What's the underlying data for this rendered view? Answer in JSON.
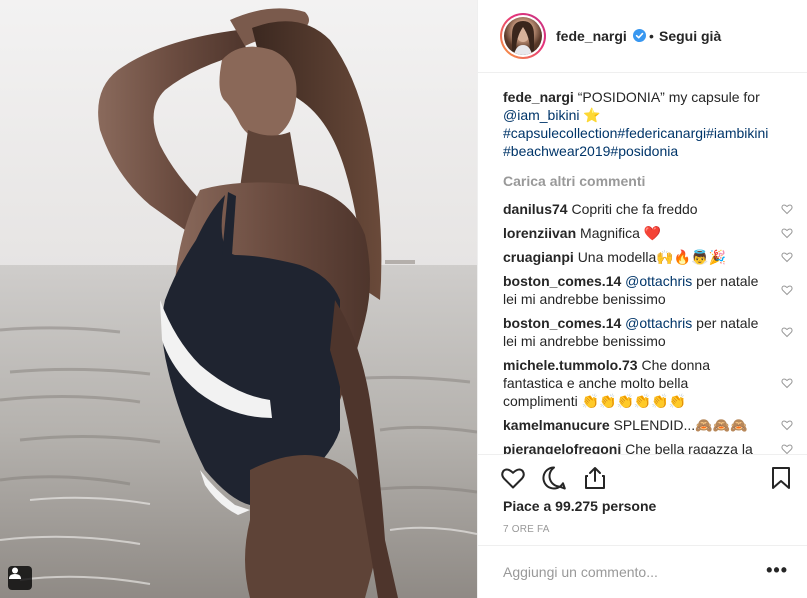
{
  "post": {
    "username": "fede_nargi",
    "verified": true,
    "follow_label": "Segui già",
    "separator": "•",
    "caption_user": "fede_nargi",
    "caption_text": "“POSIDONIA” my capsule for",
    "caption_mention": "@iam_bikini",
    "caption_emoji": "⭐",
    "caption_hashtags_line1": "#capsulecollection#federicanargi#iambikini",
    "caption_hashtags_line2": "#beachwear2019#posidonia"
  },
  "load_more_label": "Carica altri commenti",
  "comments": [
    {
      "user": "danilus74",
      "text": "Copriti che fa freddo"
    },
    {
      "user": "lorenziivan",
      "text": "Magnifica ❤️"
    },
    {
      "user": "cruagianpi",
      "text": "Una modella🙌🔥👼🎉"
    },
    {
      "user": "boston_comes.14",
      "mention": "@ottachris",
      "text": " per natale lei mi andrebbe benissimo"
    },
    {
      "user": "boston_comes.14",
      "mention": "@ottachris",
      "text": " per natale lei mi andrebbe benissimo"
    },
    {
      "user": "michele.tummolo.73",
      "text": "Che donna fantastica e anche molto bella complimenti 👏👏👏👏👏👏"
    },
    {
      "user": "kamelmanucure",
      "text": "SPLENDID...🙈🙈🙈"
    },
    {
      "user": "pierangelofregoni",
      "text": "Che bella ragazza la"
    }
  ],
  "likes_text": "Piace a 99.275 persone",
  "timestamp": "7 ORE FA",
  "add_comment_placeholder": "Aggiungi un commento...",
  "more_label": "•••",
  "icons": {
    "like": "heart-icon",
    "comment": "comment-icon",
    "share": "share-icon",
    "save": "bookmark-icon",
    "verified": "verified-badge-icon",
    "tag": "user-tag-icon"
  },
  "colors": {
    "text": "#262626",
    "muted": "#999999",
    "link": "#003569",
    "verified": "#3897f0",
    "heart": "#ed4956"
  }
}
